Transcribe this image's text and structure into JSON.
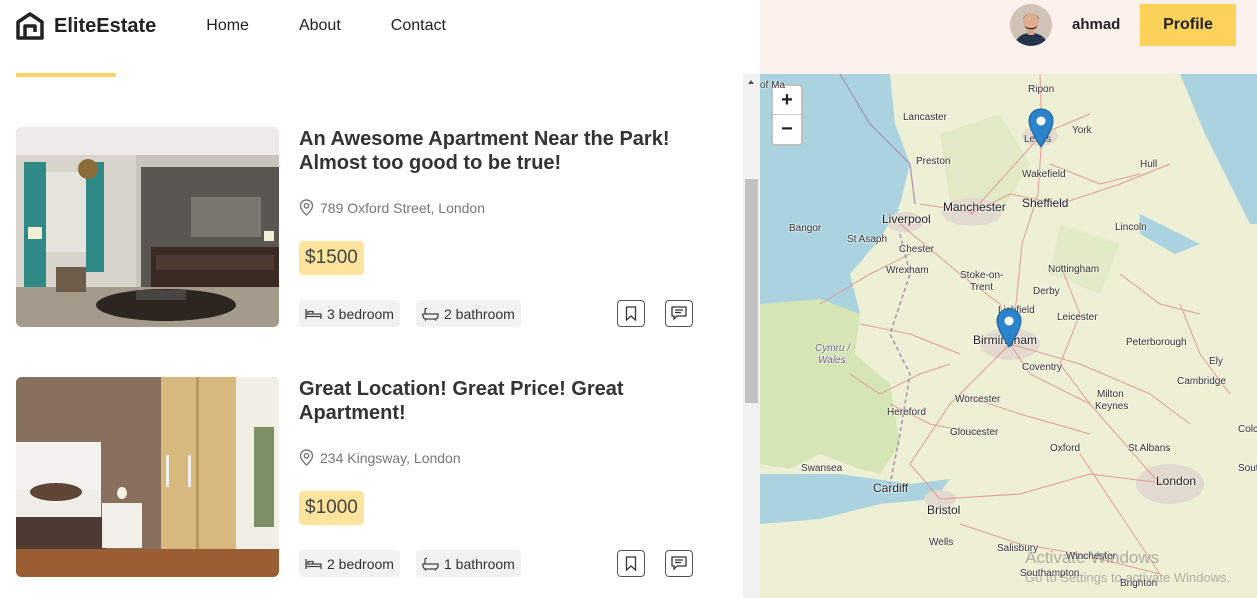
{
  "brand": {
    "name": "EliteEstate"
  },
  "nav": {
    "home": "Home",
    "about": "About",
    "contact": "Contact"
  },
  "user": {
    "name": "ahmad",
    "profile_label": "Profile"
  },
  "listings": [
    {
      "title": "An Awesome Apartment Near the Park! Almost too good to be true!",
      "address": "789 Oxford Street, London",
      "price": "$1500",
      "bedrooms": "3 bedroom",
      "bathrooms": "2 bathroom"
    },
    {
      "title": "Great Location! Great Price! Great Apartment!",
      "address": "234 Kingsway, London",
      "price": "$1000",
      "bedrooms": "2 bedroom",
      "bathrooms": "1 bathroom"
    }
  ],
  "map": {
    "zoom_in": "+",
    "zoom_out": "−",
    "partial_label": "of Ma",
    "cities": {
      "ripon": "Ripon",
      "lancaster": "Lancaster",
      "york": "York",
      "leeds": "Leeds",
      "preston": "Preston",
      "wakefield": "Wakefield",
      "hull": "Hull",
      "manchester": "Manchester",
      "sheffield": "Sheffield",
      "liverpool": "Liverpool",
      "bangor": "Bangor",
      "st_asaph": "St Asaph",
      "lincoln": "Lincoln",
      "chester": "Chester",
      "wrexham": "Wrexham",
      "stoke": "Stoke-on-",
      "trent": "Trent",
      "nottingham": "Nottingham",
      "derby": "Derby",
      "lichfield": "Lichfield",
      "leicester": "Leicester",
      "cymru": "Cymru /",
      "wales": "Wales",
      "birmingham": "Birmingham",
      "peterborough": "Peterborough",
      "ely": "Ely",
      "coventry": "Coventry",
      "cambridge": "Cambridge",
      "worcester": "Worcester",
      "milton": "Milton",
      "keynes": "Keynes",
      "hereford": "Hereford",
      "gloucester": "Gloucester",
      "oxford": "Oxford",
      "st_albans": "St Albans",
      "swansea": "Swansea",
      "cardiff": "Cardiff",
      "london": "London",
      "bristol": "Bristol",
      "wells": "Wells",
      "salisbury": "Salisbury",
      "winchester": "Winchester",
      "southampton": "Southampton",
      "brighton": "Brighton",
      "colchester": "Colches",
      "southend": "Southen"
    },
    "watermark_title": "Activate Windows",
    "watermark_sub": "Go to Settings to activate Windows."
  },
  "colors": {
    "accent": "#fcd25a",
    "price_bg": "#fde49d",
    "header_right_bg": "#fdf1ee",
    "marker": "#2b83cb"
  },
  "icons": {
    "logo": "house-outline-icon",
    "location": "map-pin-icon",
    "bed": "bed-icon",
    "bath": "bathtub-icon",
    "bookmark": "bookmark-icon",
    "message": "chat-bubble-icon"
  }
}
